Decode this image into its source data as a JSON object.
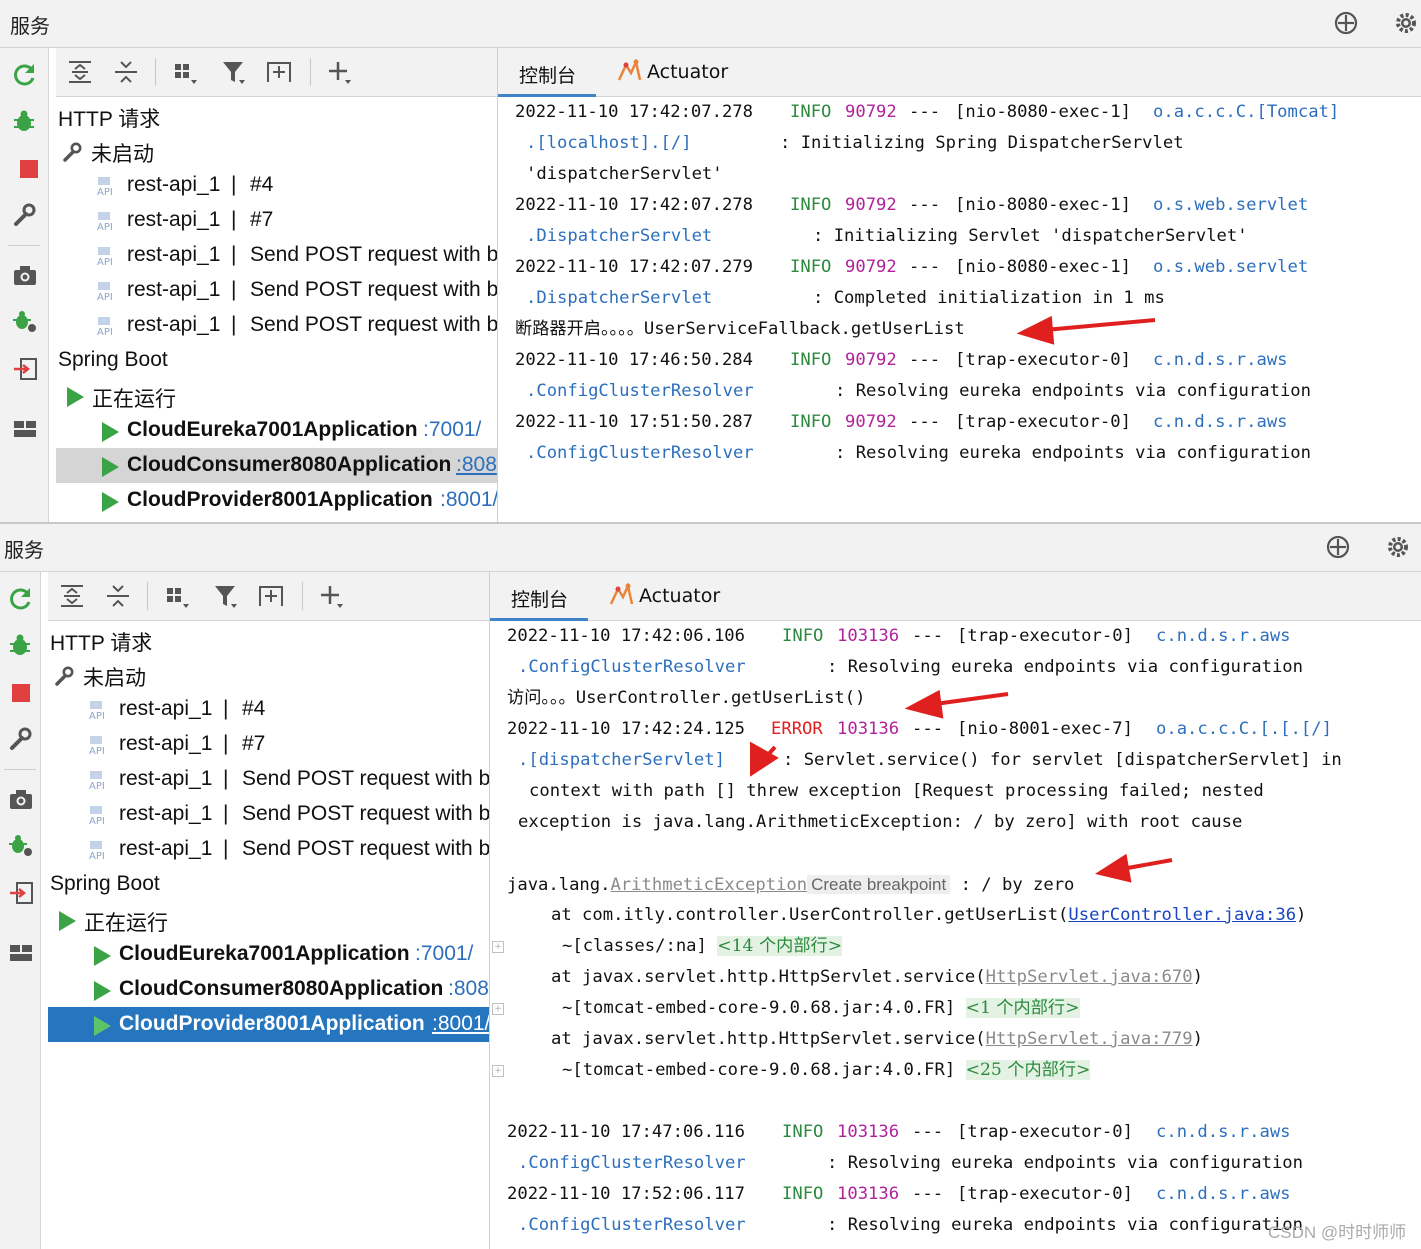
{
  "top": {
    "title": "服务",
    "tree": {
      "http_group": "HTTP 请求",
      "not_started": "未启动",
      "requests": [
        {
          "name": "rest-api_1",
          "sep": "|",
          "label": "#4"
        },
        {
          "name": "rest-api_1",
          "sep": "|",
          "label": "#7"
        },
        {
          "name": "rest-api_1",
          "sep": "|",
          "label": "Send POST request with b"
        },
        {
          "name": "rest-api_1",
          "sep": "|",
          "label": "Send POST request with b"
        },
        {
          "name": "rest-api_1",
          "sep": "|",
          "label": "Send POST request with b"
        }
      ],
      "spring_boot": "Spring Boot",
      "running": "正在运行",
      "apps": [
        {
          "name": "CloudEureka7001Application",
          "port": ":7001/"
        },
        {
          "name": "CloudConsumer8080Application",
          "port": ":808"
        },
        {
          "name": "CloudProvider8001Application",
          "port": ":8001/"
        }
      ]
    },
    "tabs": {
      "console": "控制台",
      "actuator": "Actuator"
    },
    "log": [
      {
        "ts": "2022-11-10 17:42:07.278",
        "level": "INFO",
        "pid": "90792",
        "sep": "---",
        "thread": "[nio-8080-exec-1]",
        "logger": "o.a.c.c.C.[Tomcat]"
      },
      {
        "logger2": ".[localhost].[/]",
        "msg": ": Initializing Spring DispatcherServlet"
      },
      {
        "msg": "'dispatcherServlet'"
      },
      {
        "ts": "2022-11-10 17:42:07.278",
        "level": "INFO",
        "pid": "90792",
        "sep": "---",
        "thread": "[nio-8080-exec-1]",
        "logger": "o.s.web.servlet"
      },
      {
        "logger2": ".DispatcherServlet",
        "msg": ": Initializing Servlet 'dispatcherServlet'"
      },
      {
        "ts": "2022-11-10 17:42:07.279",
        "level": "INFO",
        "pid": "90792",
        "sep": "---",
        "thread": "[nio-8080-exec-1]",
        "logger": "o.s.web.servlet"
      },
      {
        "logger2": ".DispatcherServlet",
        "msg": ": Completed initialization in 1 ms"
      },
      {
        "msg": "断路器开启。。。。UserServiceFallback.getUserList"
      },
      {
        "ts": "2022-11-10 17:46:50.284",
        "level": "INFO",
        "pid": "90792",
        "sep": "---",
        "thread": "[trap-executor-0]",
        "logger": "c.n.d.s.r.aws"
      },
      {
        "logger2": ".ConfigClusterResolver",
        "msg": ": Resolving eureka endpoints via configuration"
      },
      {
        "ts": "2022-11-10 17:51:50.287",
        "level": "INFO",
        "pid": "90792",
        "sep": "---",
        "thread": "[trap-executor-0]",
        "logger": "c.n.d.s.r.aws"
      },
      {
        "logger2": ".ConfigClusterResolver",
        "msg": ": Resolving eureka endpoints via configuration"
      }
    ]
  },
  "bottom": {
    "title": "服务",
    "tree": {
      "http_group": "HTTP 请求",
      "not_started": "未启动",
      "requests": [
        {
          "name": "rest-api_1",
          "sep": "|",
          "label": "#4"
        },
        {
          "name": "rest-api_1",
          "sep": "|",
          "label": "#7"
        },
        {
          "name": "rest-api_1",
          "sep": "|",
          "label": "Send POST request with b"
        },
        {
          "name": "rest-api_1",
          "sep": "|",
          "label": "Send POST request with b"
        },
        {
          "name": "rest-api_1",
          "sep": "|",
          "label": "Send POST request with b"
        }
      ],
      "spring_boot": "Spring Boot",
      "running": "正在运行",
      "apps": [
        {
          "name": "CloudEureka7001Application",
          "port": ":7001/"
        },
        {
          "name": "CloudConsumer8080Application",
          "port": ":808"
        },
        {
          "name": "CloudProvider8001Application",
          "port": ":8001/"
        }
      ]
    },
    "tabs": {
      "console": "控制台",
      "actuator": "Actuator"
    },
    "log": {
      "l1": {
        "ts": "2022-11-10 17:42:06.106",
        "level": "INFO",
        "pid": "103136",
        "sep": "---",
        "thread": "[trap-executor-0]",
        "logger": "c.n.d.s.r.aws"
      },
      "l2": {
        "logger2": ".ConfigClusterResolver",
        "msg": ": Resolving eureka endpoints via configuration"
      },
      "l3": {
        "msg": "访问。。。UserController.getUserList()"
      },
      "l4": {
        "ts": "2022-11-10 17:42:24.125",
        "level": "ERROR",
        "pid": "103136",
        "sep": "---",
        "thread": "[nio-8001-exec-7]",
        "logger": "o.a.c.c.C.[.[.[/]"
      },
      "l5": {
        "logger2": ".[dispatcherServlet]",
        "msg": ": Servlet.service() for servlet [dispatcherServlet] in"
      },
      "l6": {
        "msg": "context with path [] threw exception [Request processing failed; nested"
      },
      "l7": {
        "msg": "exception is java.lang.ArithmeticException: / by zero] with root cause"
      },
      "l8": {
        "prefix": "java.lang.",
        "exc": "ArithmeticException",
        "hint": "Create breakpoint",
        "suffix": " : / by zero"
      },
      "l9": {
        "prefix": "at com.itly.controller.UserController.getUserList(",
        "link": "UserController.java:36",
        "suffix": ")"
      },
      "l10": {
        "prefix": "~[classes/:na] ",
        "fold": "<14 个内部行>"
      },
      "l11": {
        "prefix": "at javax.servlet.http.HttpServlet.service(",
        "link": "HttpServlet.java:670",
        "suffix": ")"
      },
      "l12": {
        "prefix": "~[tomcat-embed-core-9.0.68.jar:4.0.FR] ",
        "fold": "<1 个内部行>"
      },
      "l13": {
        "prefix": "at javax.servlet.http.HttpServlet.service(",
        "link": "HttpServlet.java:779",
        "suffix": ")"
      },
      "l14": {
        "prefix": "~[tomcat-embed-core-9.0.68.jar:4.0.FR] ",
        "fold": "<25 个内部行>"
      },
      "l15": {
        "ts": "2022-11-10 17:47:06.116",
        "level": "INFO",
        "pid": "103136",
        "sep": "---",
        "thread": "[trap-executor-0]",
        "logger": "c.n.d.s.r.aws"
      },
      "l16": {
        "logger2": ".ConfigClusterResolver",
        "msg": ": Resolving eureka endpoints via configuration"
      },
      "l17": {
        "ts": "2022-11-10 17:52:06.117",
        "level": "INFO",
        "pid": "103136",
        "sep": "---",
        "thread": "[trap-executor-0]",
        "logger": "c.n.d.s.r.aws"
      },
      "l18": {
        "logger2": ".ConfigClusterResolver",
        "msg": ": Resolving eureka endpoints via configuration"
      }
    }
  },
  "watermark": "CSDN @时时师师",
  "colors": {
    "info": "#2b8a3e",
    "pid": "#b0229a",
    "logger": "#2d6fbd",
    "error": "#e0201e",
    "selection": "#2675bf",
    "arrow": "#e0201e"
  },
  "icons": [
    "rerun-icon",
    "debug-icon",
    "stop-icon",
    "wrench-icon",
    "camera-icon",
    "bug-settings-icon",
    "attach-icon",
    "layout-icon",
    "expand-all-icon",
    "collapse-all-icon",
    "group-icon",
    "filter-icon",
    "new-tab-icon",
    "add-icon",
    "crosshair-icon",
    "gear-icon",
    "api-icon",
    "play-icon"
  ]
}
